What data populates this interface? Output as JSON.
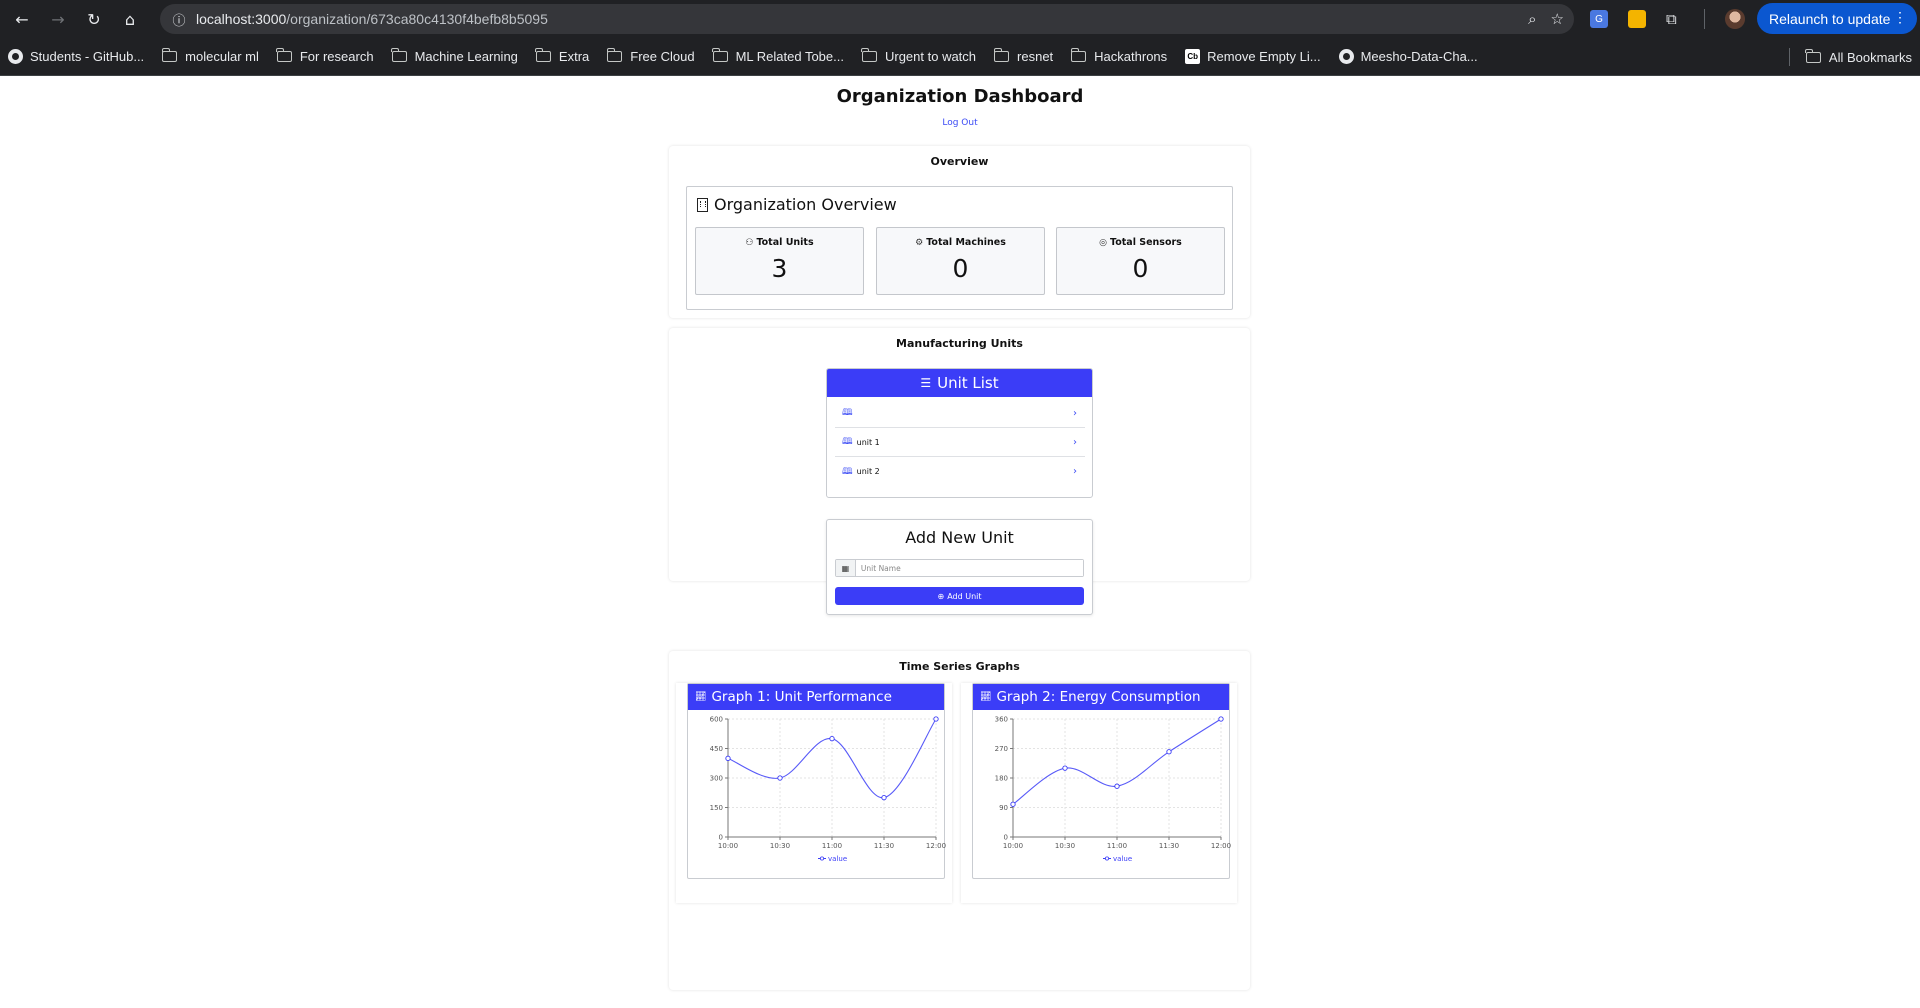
{
  "browser": {
    "url_host": "localhost:3000",
    "url_path": "/organization/673ca80c4130f4befb8b5095",
    "relaunch_label": "Relaunch to update",
    "bookmarks": [
      {
        "label": "Students - GitHub...",
        "icon": "github-icon"
      },
      {
        "label": "molecular ml",
        "icon": "folder-icon"
      },
      {
        "label": "For research",
        "icon": "folder-icon"
      },
      {
        "label": "Machine Learning",
        "icon": "folder-icon"
      },
      {
        "label": "Extra",
        "icon": "folder-icon"
      },
      {
        "label": "Free Cloud",
        "icon": "folder-icon"
      },
      {
        "label": "ML Related Tobe...",
        "icon": "folder-icon"
      },
      {
        "label": "Urgent to watch",
        "icon": "folder-icon"
      },
      {
        "label": "resnet",
        "icon": "folder-icon"
      },
      {
        "label": "Hackathrons",
        "icon": "folder-icon"
      },
      {
        "label": "Remove Empty Li...",
        "icon": "cb-icon"
      },
      {
        "label": "Meesho-Data-Cha...",
        "icon": "github-icon"
      }
    ],
    "all_bookmarks_label": "All Bookmarks"
  },
  "header": {
    "title": "Organization Dashboard",
    "logout_label": "Log Out"
  },
  "overview": {
    "section_title": "Overview",
    "heading": "Organization Overview",
    "stats": [
      {
        "label": "Total Units",
        "value": "3",
        "icon": "users-icon"
      },
      {
        "label": "Total Machines",
        "value": "0",
        "icon": "cog-icon"
      },
      {
        "label": "Total Sensors",
        "value": "0",
        "icon": "sensor-icon"
      }
    ]
  },
  "units": {
    "section_title": "Manufacturing Units",
    "list_title": "Unit List",
    "items": [
      {
        "label": ""
      },
      {
        "label": "unit 1"
      },
      {
        "label": "unit 2"
      }
    ],
    "add_title": "Add New Unit",
    "input_placeholder": "Unit Name",
    "input_value": "",
    "add_button_label": "Add Unit"
  },
  "graphs": {
    "section_title": "Time Series Graphs",
    "accent_color": "#3b3df7"
  },
  "chart_data": [
    {
      "type": "line",
      "title": "Graph 1: Unit Performance",
      "x": [
        "10:00",
        "10:30",
        "11:00",
        "11:30",
        "12:00"
      ],
      "series": [
        {
          "name": "value",
          "values": [
            400,
            300,
            500,
            200,
            600
          ]
        }
      ],
      "yticks": [
        0,
        150,
        300,
        450,
        600
      ],
      "ytick_labels": [
        "0",
        "150",
        "300",
        "450",
        "600"
      ],
      "ylim": [
        0,
        600
      ],
      "grid": true,
      "legend": "bottom"
    },
    {
      "type": "line",
      "title": "Graph 2: Energy Consumption",
      "x": [
        "10:00",
        "10:30",
        "11:00",
        "11:30",
        "12:00"
      ],
      "series": [
        {
          "name": "value",
          "values": [
            100,
            210,
            155,
            260,
            360
          ]
        }
      ],
      "yticks": [
        0,
        90,
        180,
        270,
        360
      ],
      "ytick_labels": [
        "0",
        "90",
        "180",
        "270",
        "360"
      ],
      "ylim": [
        0,
        360
      ],
      "grid": true,
      "legend": "bottom"
    }
  ]
}
